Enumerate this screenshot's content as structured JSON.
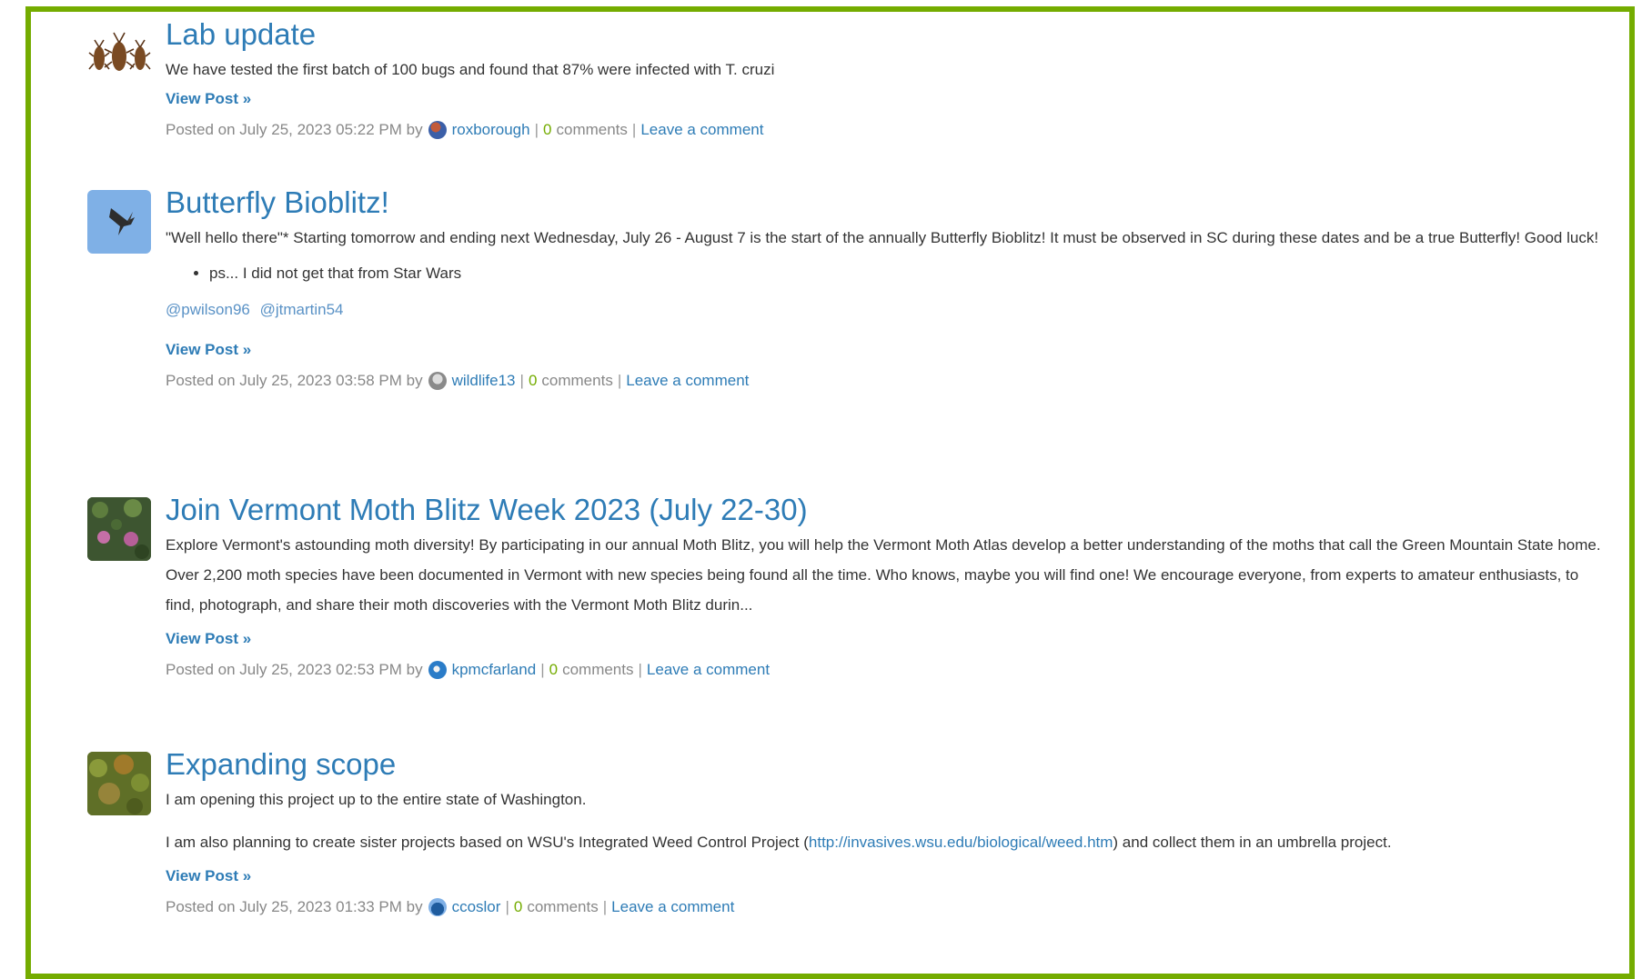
{
  "posts": [
    {
      "title": "Lab update",
      "paragraphs": [
        "We have tested the first batch of 100 bugs and found that 87% were infected with T. cruzi"
      ],
      "view_label": "View Post »",
      "meta": {
        "posted": "Posted on July 25, 2023 05:22 PM by",
        "user": "roxborough",
        "sep": "|",
        "count": "0",
        "comments_label": "comments",
        "leave_label": "Leave a comment"
      }
    },
    {
      "title": "Butterfly Bioblitz!",
      "paragraphs": [
        "\"Well hello there\"* Starting tomorrow and ending next Wednesday, July 26 - August 7 is the start of the annually Butterfly Bioblitz! It must be observed in SC during these dates and be a true Butterfly! Good luck!"
      ],
      "bullets": [
        "ps... I did not get that from Star Wars"
      ],
      "mentions": [
        "@pwilson96",
        "@jtmartin54"
      ],
      "view_label": "View Post »",
      "meta": {
        "posted": "Posted on July 25, 2023 03:58 PM by",
        "user": "wildlife13",
        "sep": "|",
        "count": "0",
        "comments_label": "comments",
        "leave_label": "Leave a comment"
      }
    },
    {
      "title": "Join Vermont Moth Blitz Week 2023 (July 22-30)",
      "paragraphs": [
        "Explore Vermont's astounding moth diversity! By participating in our annual Moth Blitz, you will help the Vermont Moth Atlas develop a better understanding of the moths that call the Green Mountain State home. Over 2,200 moth species have been documented in Vermont with new species being found all the time. Who knows, maybe you will find one! We encourage everyone, from experts to amateur enthusiasts, to find, photograph, and share their moth discoveries with the Vermont Moth Blitz durin..."
      ],
      "view_label": "View Post »",
      "meta": {
        "posted": "Posted on July 25, 2023 02:53 PM by",
        "user": "kpmcfarland",
        "sep": "|",
        "count": "0",
        "comments_label": "comments",
        "leave_label": "Leave a comment"
      }
    },
    {
      "title": "Expanding scope",
      "paragraphs": [
        "I am opening this project up to the entire state of Washington."
      ],
      "para2_before": "I am also planning to create sister projects based on WSU's Integrated Weed Control Project (",
      "para2_link": "http://invasives.wsu.edu/biological/weed.htm",
      "para2_after": ") and collect them in an umbrella project.",
      "view_label": "View Post »",
      "meta": {
        "posted": "Posted on July 25, 2023 01:33 PM by",
        "user": "ccoslor",
        "sep": "|",
        "count": "0",
        "comments_label": "comments",
        "leave_label": "Leave a comment"
      }
    }
  ],
  "colors": {
    "frame": "#74ac00",
    "link": "#2e7cb6",
    "count": "#74ac00"
  }
}
